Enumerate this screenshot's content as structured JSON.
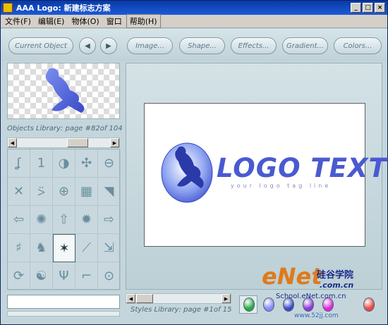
{
  "window": {
    "title": "AAA Logo: 新建标志方案"
  },
  "title_buttons": {
    "minimize": "_",
    "maximize": "□",
    "close": "×"
  },
  "menu": [
    "文件(F)",
    "编辑(E)",
    "物体(O)",
    "窗口",
    "帮助(H)"
  ],
  "toolbar": {
    "current_object": "Current Object",
    "prev": "◀",
    "next": "▶",
    "image": "Image...",
    "shape": "Shape...",
    "effects": "Effects...",
    "gradient": "Gradient...",
    "colors": "Colors..."
  },
  "objects_library": {
    "label": "Objects Library: page #82of 104"
  },
  "styles_library": {
    "label": "Styles Library: page #1of 15"
  },
  "canvas": {
    "logo_text": "LOGO TEXT",
    "tag_line": "your logo tag line"
  },
  "symbols": [
    "ʆ",
    "1",
    "◑",
    "✣",
    "⊖",
    "✕",
    "⍩",
    "⊕",
    "▦",
    "◥",
    "⇦",
    "✺",
    "⇧",
    "✹",
    "⇨",
    "♯",
    "♞",
    "✶",
    "⟋",
    "⇲",
    "⟳",
    "☯",
    "Ψ",
    "⌐",
    "⊙"
  ],
  "swatch_colors": [
    "#2aa848",
    "#8a8aff",
    "#3a4ac8",
    "#8a3ad8",
    "#d82ad8",
    "#e84848"
  ],
  "watermark": {
    "enet": "eNet",
    "com_cn": ".com.cn",
    "silicon": "硅谷学院",
    "school": "School.eNet.com.cn",
    "site": "www.52jj.com"
  },
  "accent_colors": {
    "titlebar": "#0a3aa6",
    "logo": "#4a5ad0",
    "panel": "#c4d6dc"
  }
}
